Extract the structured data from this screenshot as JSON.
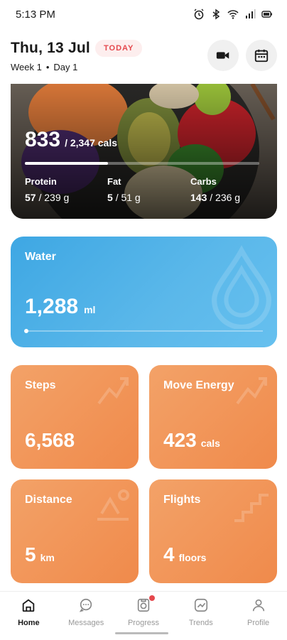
{
  "status_bar": {
    "time": "5:13 PM"
  },
  "header": {
    "date": "Thu, 13 Jul",
    "badge": "TODAY",
    "week": "Week 1",
    "separator": "•",
    "day": "Day 1",
    "buttons": [
      "video-icon",
      "calendar-icon"
    ]
  },
  "nutrition": {
    "calories": "833",
    "calories_target": "/ 2,347 cals",
    "calorie_progress": 0.355,
    "macros": [
      {
        "label": "Protein",
        "value": "57",
        "target": "/ 239 g"
      },
      {
        "label": "Fat",
        "value": "5",
        "target": "/ 51 g"
      },
      {
        "label": "Carbs",
        "value": "143",
        "target": "/ 236 g"
      }
    ]
  },
  "water": {
    "title": "Water",
    "value": "1,288",
    "unit": "ml",
    "progress": 0.0
  },
  "stats": [
    {
      "title": "Steps",
      "value": "6,568",
      "unit": ""
    },
    {
      "title": "Move Energy",
      "value": "423",
      "unit": "cals"
    },
    {
      "title": "Distance",
      "value": "5",
      "unit": "km"
    },
    {
      "title": "Flights",
      "value": "4",
      "unit": "floors"
    }
  ],
  "tabs": [
    {
      "label": "Home",
      "icon": "home-icon",
      "active": true
    },
    {
      "label": "Messages",
      "icon": "messages-icon",
      "active": false
    },
    {
      "label": "Progress",
      "icon": "progress-icon",
      "active": false
    },
    {
      "label": "Trends",
      "icon": "trends-icon",
      "active": false
    },
    {
      "label": "Profile",
      "icon": "profile-icon",
      "active": false
    }
  ],
  "colors": {
    "accent_red": "#e5484d",
    "water_blue": "#4eb0e8",
    "stat_orange": "#f08a4b"
  }
}
